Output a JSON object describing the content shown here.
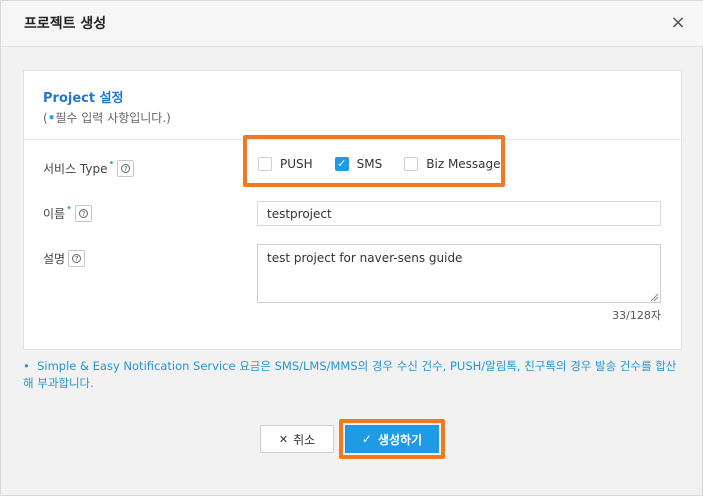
{
  "dialog": {
    "title": "프로젝트 생성",
    "close_glyph": "×"
  },
  "card": {
    "title": "Project 설정",
    "subtitle_open": "(",
    "subtitle_dot": "•",
    "subtitle_text": "필수 입력 사항입니다.)"
  },
  "form": {
    "service_type": {
      "label": "서비스 Type",
      "options": [
        {
          "label": "PUSH",
          "checked": false
        },
        {
          "label": "SMS",
          "checked": true
        },
        {
          "label": "Biz Message",
          "checked": false
        }
      ]
    },
    "name": {
      "label": "이름",
      "value": "testproject"
    },
    "description": {
      "label": "설명",
      "value": "test project for naver-sens guide",
      "counter": "33/128자"
    },
    "required_dot": "•",
    "help_glyph": "?"
  },
  "notice": {
    "bullet": "•",
    "text": "Simple & Easy Notification Service 요금은 SMS/LMS/MMS의 경우 수신 건수, PUSH/알림톡, 친구톡의 경우 발송 건수를 합산해 부과합니다."
  },
  "buttons": {
    "cancel_icon": "✕",
    "cancel_label": "취소",
    "create_icon": "✓",
    "create_label": "생성하기"
  },
  "colors": {
    "accent": "#1f9be6",
    "highlight": "#f07a23",
    "title_blue": "#2378c7"
  }
}
